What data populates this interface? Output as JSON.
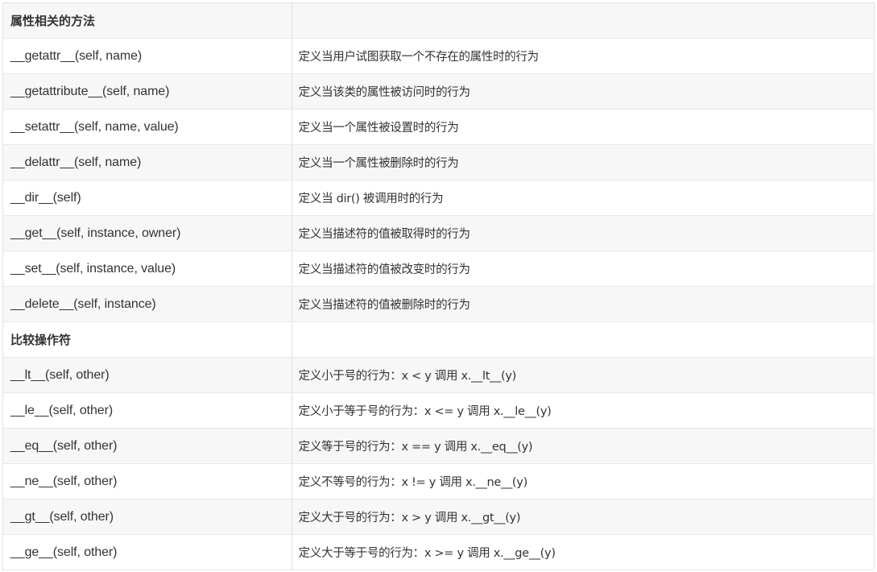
{
  "rows": [
    {
      "type": "section",
      "name": "属性相关的方法",
      "desc": ""
    },
    {
      "type": "item",
      "name": "__getattr__(self, name)",
      "desc": "定义当用户试图获取一个不存在的属性时的行为"
    },
    {
      "type": "item",
      "name": "__getattribute__(self, name)",
      "desc": "定义当该类的属性被访问时的行为"
    },
    {
      "type": "item",
      "name": "__setattr__(self, name, value)",
      "desc": "定义当一个属性被设置时的行为"
    },
    {
      "type": "item",
      "name": "__delattr__(self, name)",
      "desc": "定义当一个属性被删除时的行为"
    },
    {
      "type": "item",
      "name": "__dir__(self)",
      "desc": "定义当 dir() 被调用时的行为"
    },
    {
      "type": "item",
      "name": "__get__(self, instance, owner)",
      "desc": "定义当描述符的值被取得时的行为"
    },
    {
      "type": "item",
      "name": "__set__(self, instance, value)",
      "desc": "定义当描述符的值被改变时的行为"
    },
    {
      "type": "item",
      "name": "__delete__(self, instance)",
      "desc": "定义当描述符的值被删除时的行为"
    },
    {
      "type": "section",
      "name": "比较操作符",
      "desc": ""
    },
    {
      "type": "item",
      "name": "__lt__(self, other)",
      "desc": "定义小于号的行为：x < y 调用 x.__lt__(y)"
    },
    {
      "type": "item",
      "name": "__le__(self, other)",
      "desc": "定义小于等于号的行为：x <= y 调用 x.__le__(y)"
    },
    {
      "type": "item",
      "name": "__eq__(self, other)",
      "desc": "定义等于号的行为：x == y 调用 x.__eq__(y)"
    },
    {
      "type": "item",
      "name": "__ne__(self, other)",
      "desc": "定义不等号的行为：x != y 调用 x.__ne__(y)"
    },
    {
      "type": "item",
      "name": "__gt__(self, other)",
      "desc": "定义大于号的行为：x > y 调用 x.__gt__(y)"
    },
    {
      "type": "item",
      "name": "__ge__(self, other)",
      "desc": "定义大于等于号的行为：x >= y 调用 x.__ge__(y)"
    }
  ]
}
